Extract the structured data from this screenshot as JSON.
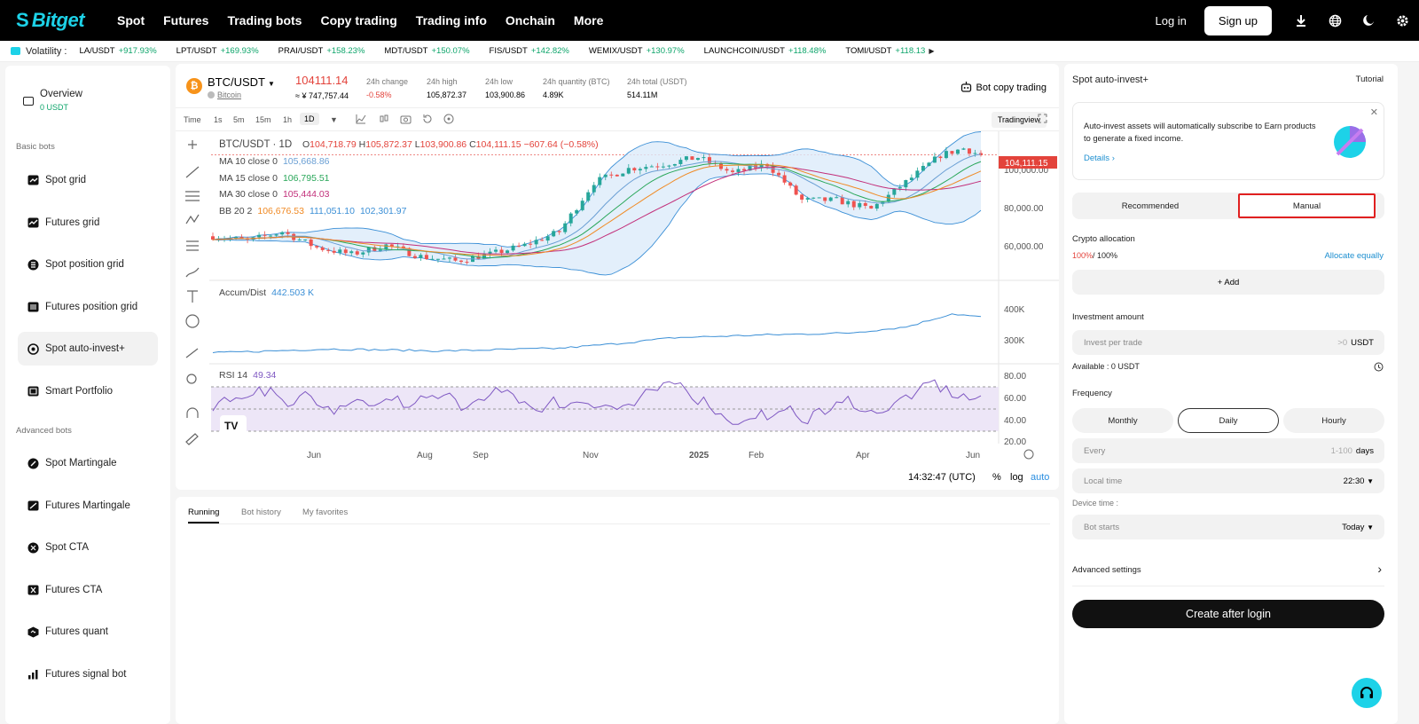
{
  "nav": {
    "logo": "Bitget",
    "items": [
      "Spot",
      "Futures",
      "Trading bots",
      "Copy trading",
      "Trading info",
      "Onchain",
      "More"
    ],
    "login": "Log in",
    "signup": "Sign up"
  },
  "ticker": {
    "label": "Volatility :",
    "items": [
      {
        "pair": "LA/USDT",
        "change": "+917.93%"
      },
      {
        "pair": "LPT/USDT",
        "change": "+169.93%"
      },
      {
        "pair": "PRAI/USDT",
        "change": "+158.23%"
      },
      {
        "pair": "MDT/USDT",
        "change": "+150.07%"
      },
      {
        "pair": "FIS/USDT",
        "change": "+142.82%"
      },
      {
        "pair": "WEMIX/USDT",
        "change": "+130.97%"
      },
      {
        "pair": "LAUNCHCOIN/USDT",
        "change": "+118.48%"
      },
      {
        "pair": "TOMI/USDT",
        "change": "+118.13"
      }
    ]
  },
  "sidebar": {
    "overview": {
      "label": "Overview",
      "balance": "0 USDT"
    },
    "basic_heading": "Basic bots",
    "basic": [
      "Spot grid",
      "Futures grid",
      "Spot position grid",
      "Futures position grid",
      "Spot auto-invest+",
      "Smart Portfolio"
    ],
    "advanced_heading": "Advanced bots",
    "advanced": [
      "Spot Martingale",
      "Futures Martingale",
      "Spot CTA",
      "Futures CTA",
      "Futures quant",
      "Futures signal bot"
    ]
  },
  "market": {
    "pair": "BTC/USDT",
    "coin_name": "Bitcoin",
    "last_price": "104111.14",
    "converted": "≈ ¥ 747,757.44",
    "stats": [
      {
        "label": "24h change",
        "value": "-0.58%"
      },
      {
        "label": "24h high",
        "value": "105,872.37"
      },
      {
        "label": "24h low",
        "value": "103,900.86"
      },
      {
        "label": "24h quantity (BTC)",
        "value": "4.89K"
      },
      {
        "label": "24h total (USDT)",
        "value": "514.11M"
      }
    ],
    "bot_copy": "Bot copy trading",
    "timeframes": [
      "Time",
      "1s",
      "5m",
      "15m",
      "1h",
      "1D"
    ],
    "tradingview": "Tradingview",
    "time": "14:32:47 (UTC)",
    "scale_opts": [
      "%",
      "log",
      "auto"
    ]
  },
  "chart_data": {
    "type": "candlestick",
    "title": "BTC/USDT · 1D",
    "ohlc_header": {
      "O": "104,718.79",
      "H": "105,872.37",
      "L": "103,900.86",
      "C": "104,111.15",
      "change": "−607.64 (−0.58%)"
    },
    "indicators": [
      {
        "name": "MA 10 close 0",
        "value": "105,668.86"
      },
      {
        "name": "MA 15 close 0",
        "value": "106,795.51"
      },
      {
        "name": "MA 30 close 0",
        "value": "105,444.03"
      },
      {
        "name": "BB 20 2",
        "values": [
          "106,676.53",
          "111,051.10",
          "102,301.97"
        ]
      }
    ],
    "price_ticks": [
      "100,000.00",
      "80,000.00",
      "60,000.00"
    ],
    "price_ylim": [
      50000,
      113000
    ],
    "current_price_label": "104,111.15",
    "x_ticks": [
      "Jun",
      "Aug",
      "Sep",
      "Nov",
      "2025",
      "Feb",
      "Apr",
      "Jun"
    ],
    "anchors_price": [
      [
        0,
        68000
      ],
      [
        6,
        66000
      ],
      [
        12,
        70000
      ],
      [
        18,
        63000
      ],
      [
        24,
        60000
      ],
      [
        30,
        64000
      ],
      [
        36,
        59000
      ],
      [
        42,
        57000
      ],
      [
        48,
        60000
      ],
      [
        54,
        64000
      ],
      [
        60,
        70000
      ],
      [
        66,
        92000
      ],
      [
        72,
        98000
      ],
      [
        78,
        100000
      ],
      [
        84,
        103000
      ],
      [
        90,
        96000
      ],
      [
        96,
        100000
      ],
      [
        102,
        84000
      ],
      [
        108,
        84000
      ],
      [
        114,
        80000
      ],
      [
        120,
        92000
      ],
      [
        126,
        104000
      ],
      [
        130,
        107000
      ],
      [
        133,
        104000
      ]
    ],
    "accum": {
      "label": "Accum/Dist",
      "value": "442.503 K",
      "ticks": [
        "400K",
        "300K"
      ],
      "ylim": [
        240,
        470
      ],
      "anchors": [
        [
          0,
          262
        ],
        [
          20,
          274
        ],
        [
          40,
          268
        ],
        [
          60,
          276
        ],
        [
          70,
          290
        ],
        [
          80,
          308
        ],
        [
          95,
          316
        ],
        [
          110,
          322
        ],
        [
          120,
          340
        ],
        [
          128,
          380
        ],
        [
          133,
          370
        ]
      ]
    },
    "rsi": {
      "label": "RSI 14",
      "value": "49.34",
      "ticks": [
        "80.00",
        "60.00",
        "40.00",
        "20.00"
      ],
      "ylim": [
        15,
        90
      ]
    }
  },
  "bottom_tabs": [
    "Running",
    "Bot history",
    "My favorites"
  ],
  "right": {
    "title": "Spot auto-invest+",
    "tutorial": "Tutorial",
    "banner_text": "Auto-invest assets will automatically subscribe to Earn products to generate a fixed income.",
    "details": "Details",
    "modes": [
      "Recommended",
      "Manual"
    ],
    "crypto_allocation": "Crypto allocation",
    "alloc_used": "100%",
    "alloc_total": "/ 100%",
    "allocate_equally": "Allocate equally",
    "add": "+ Add",
    "investment_amount": "Investment amount",
    "invest_placeholder": "Invest per trade",
    "invest_hint": ">0",
    "invest_unit": "USDT",
    "available_label": "Available :",
    "available_value": "0 USDT",
    "frequency": "Frequency",
    "freq_opts": [
      "Monthly",
      "Daily",
      "Hourly"
    ],
    "every_label": "Every",
    "every_hint": "1-100",
    "every_unit": "days",
    "local_time_label": "Local time",
    "local_time_value": "22:30",
    "device_time": "Device time :",
    "bot_starts_label": "Bot starts",
    "bot_starts_value": "Today",
    "advanced": "Advanced settings",
    "create": "Create after login"
  },
  "colors": {
    "accent": "#1dd2e8",
    "up": "#0ea56b",
    "down": "#e3433b",
    "highlight_border": "#e02020"
  }
}
